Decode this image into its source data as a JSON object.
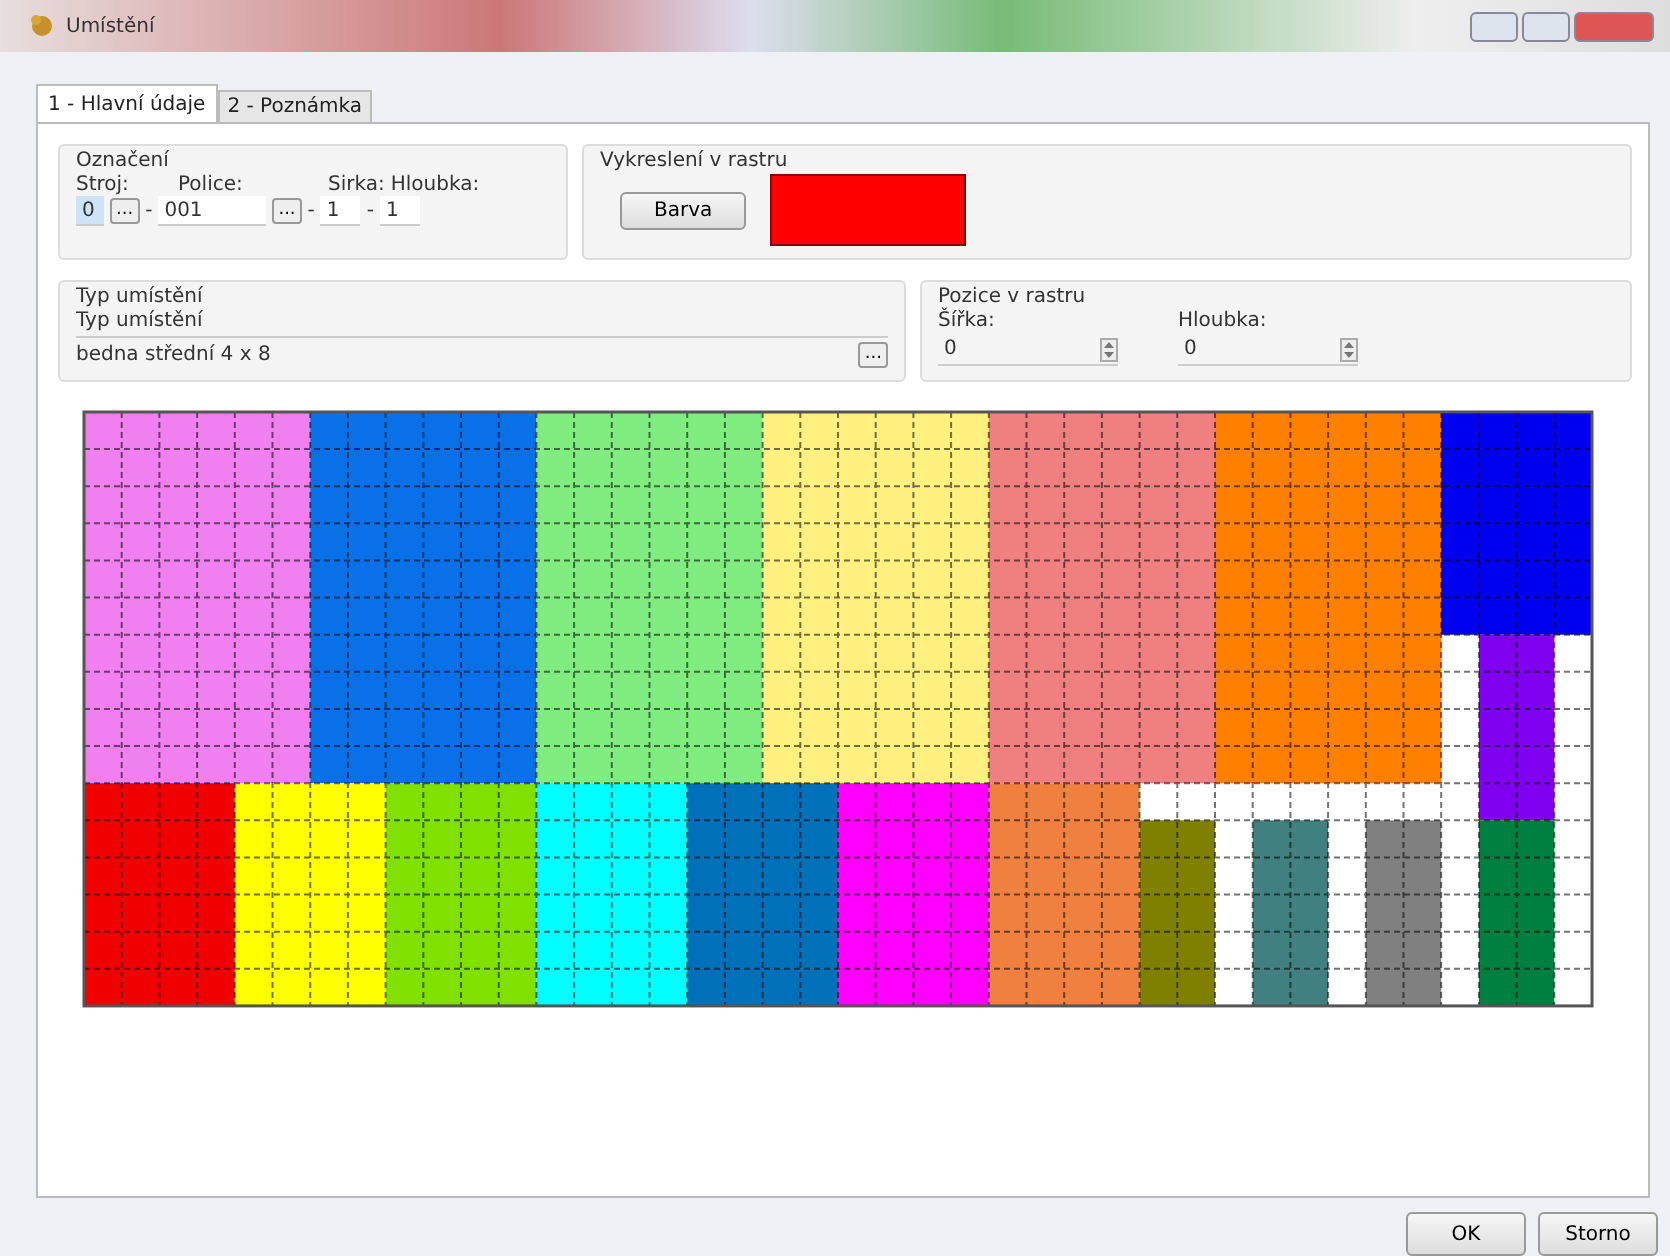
{
  "window": {
    "title": "Umístění"
  },
  "tabs": [
    {
      "label": "1 - Hlavní údaje",
      "selected": true
    },
    {
      "label": "2 - Poznámka",
      "selected": false
    }
  ],
  "oznaceni": {
    "title": "Označení",
    "stroj_label": "Stroj:",
    "stroj_value": "0",
    "police_label": "Police:",
    "police_value": "001",
    "sirka_label": "Sirka:",
    "hloubka_label": "Hloubka:",
    "sep": "-",
    "sirka_value": "1",
    "hloubka_value": "1",
    "browse": "..."
  },
  "vykresleni": {
    "title": "Vykreslení v rastru",
    "button": "Barva",
    "color": "#ff0000"
  },
  "typ": {
    "title": "Typ umístění",
    "label": "Typ umístění",
    "value": "bedna střední 4 x 8",
    "browse": "..."
  },
  "pozice": {
    "title": "Pozice v rastru",
    "sirka_label": "Šířka:",
    "sirka_value": "0",
    "hloubka_label": "Hloubka:",
    "hloubka_value": "0"
  },
  "raster": {
    "blocks": [
      {
        "color": "#f080f0"
      },
      {
        "color": "#0a70e8"
      },
      {
        "color": "#80ec80"
      },
      {
        "color": "#fff080"
      },
      {
        "color": "#f08080"
      },
      {
        "color": "#ff8000"
      },
      {
        "color": "#0000f0"
      },
      {
        "color": "#8000f0"
      },
      {
        "color": "#f00000"
      },
      {
        "color": "#ffff00"
      },
      {
        "color": "#80e000"
      },
      {
        "color": "#00ffff"
      },
      {
        "color": "#0070b8"
      },
      {
        "color": "#ff00ff"
      },
      {
        "color": "#f08040"
      },
      {
        "color": "#808000"
      },
      {
        "color": "#408080"
      },
      {
        "color": "#808080"
      },
      {
        "color": "#008040"
      }
    ]
  },
  "buttons": [
    "OK",
    "Storno"
  ]
}
